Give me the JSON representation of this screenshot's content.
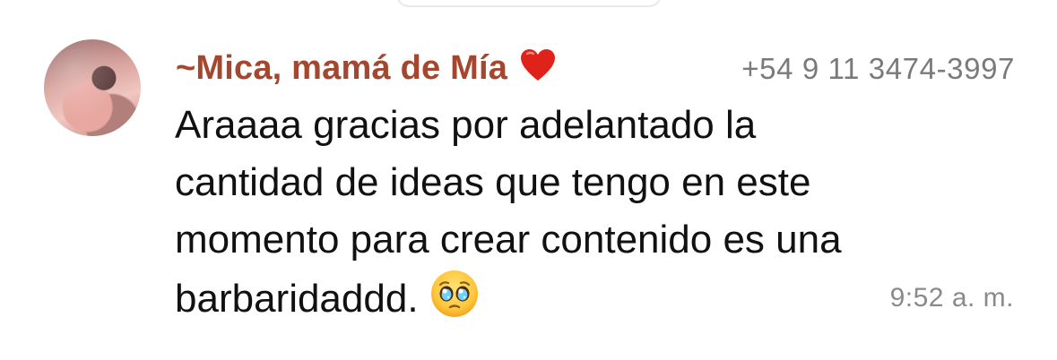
{
  "message": {
    "sender_name": "~Mica, mamá de Mía",
    "sender_emoji_icon": "red-heart-icon",
    "sender_phone": "+54 9 11 3474-3997",
    "lines": [
      "Araaaa gracias por adelantado la",
      "cantidad de ideas que tengo en este",
      "momento para crear contenido es una",
      "barbaridaddd."
    ],
    "trailing_emoji_icon": "pleading-face-icon",
    "time": "9:52 a. m."
  },
  "colors": {
    "sender_name": "#a5472f",
    "phone": "#7a7a7a",
    "text": "#111111",
    "time": "#8a8a8a"
  }
}
